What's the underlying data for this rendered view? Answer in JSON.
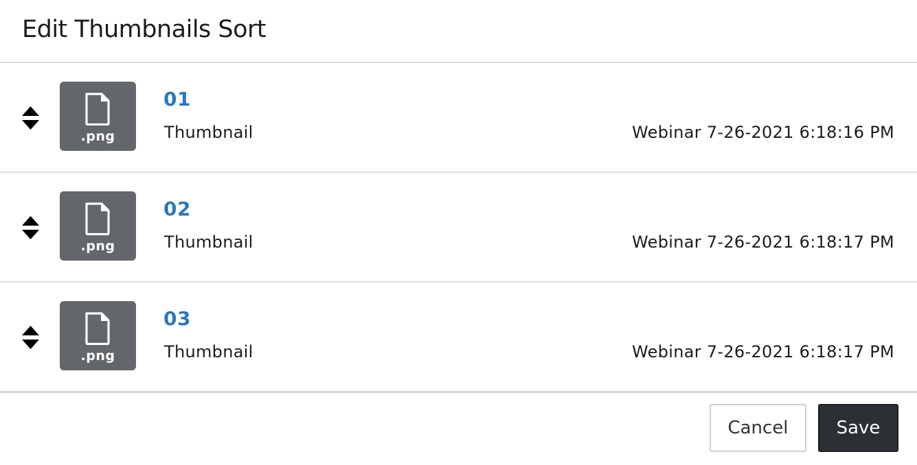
{
  "dialog": {
    "title": "Edit Thumbnails Sort"
  },
  "items": [
    {
      "number": "01",
      "label": "Thumbnail",
      "meta": "Webinar 7-26-2021 6:18:16 PM",
      "ext": ".png"
    },
    {
      "number": "02",
      "label": "Thumbnail",
      "meta": "Webinar 7-26-2021 6:18:17 PM",
      "ext": ".png"
    },
    {
      "number": "03",
      "label": "Thumbnail",
      "meta": "Webinar 7-26-2021 6:18:17 PM",
      "ext": ".png"
    }
  ],
  "footer": {
    "cancel_label": "Cancel",
    "save_label": "Save"
  },
  "colors": {
    "accent_link": "#2f78b8",
    "thumb_bg": "#63666a",
    "primary_button": "#2c3034"
  },
  "icons": {
    "drag_handle": "sort-icon",
    "file": "file-icon"
  }
}
